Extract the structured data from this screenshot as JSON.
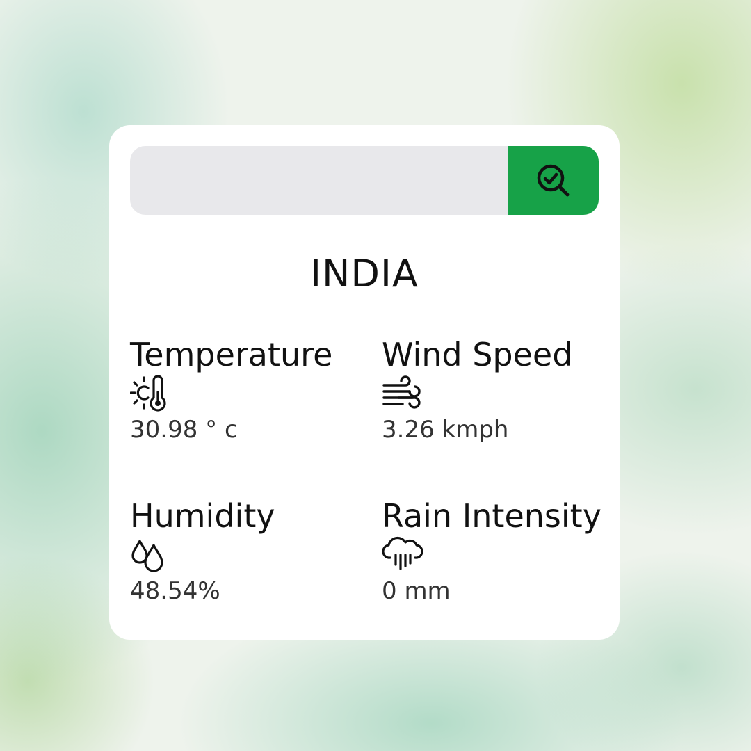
{
  "search": {
    "value": "",
    "placeholder": "",
    "button_icon": "search-check-icon"
  },
  "city": "INDIA",
  "stats": {
    "temperature": {
      "label": "Temperature",
      "icon": "sun-thermometer-icon",
      "value": "30.98 ° c"
    },
    "wind_speed": {
      "label": "Wind Speed",
      "icon": "wind-icon",
      "value": "3.26 kmph"
    },
    "humidity": {
      "label": "Humidity",
      "icon": "droplets-icon",
      "value": "48.54%"
    },
    "rain_intensity": {
      "label": "Rain Intensity",
      "icon": "cloud-rain-icon",
      "value": "0 mm"
    }
  },
  "colors": {
    "accent": "#17a248",
    "input_background": "#e8e8eb",
    "card_background": "#ffffff"
  }
}
